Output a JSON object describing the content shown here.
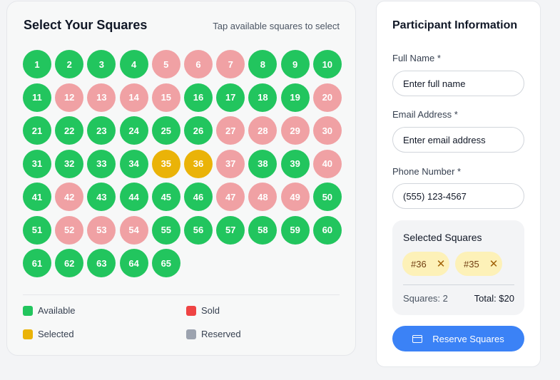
{
  "squares_panel": {
    "title": "Select Your Squares",
    "hint": "Tap available squares to select",
    "squares": [
      {
        "n": "1",
        "s": "available"
      },
      {
        "n": "2",
        "s": "available"
      },
      {
        "n": "3",
        "s": "available"
      },
      {
        "n": "4",
        "s": "available"
      },
      {
        "n": "5",
        "s": "sold"
      },
      {
        "n": "6",
        "s": "sold"
      },
      {
        "n": "7",
        "s": "sold"
      },
      {
        "n": "8",
        "s": "available"
      },
      {
        "n": "9",
        "s": "available"
      },
      {
        "n": "10",
        "s": "available"
      },
      {
        "n": "11",
        "s": "available"
      },
      {
        "n": "12",
        "s": "sold"
      },
      {
        "n": "13",
        "s": "sold"
      },
      {
        "n": "14",
        "s": "sold"
      },
      {
        "n": "15",
        "s": "sold"
      },
      {
        "n": "16",
        "s": "available"
      },
      {
        "n": "17",
        "s": "available"
      },
      {
        "n": "18",
        "s": "available"
      },
      {
        "n": "19",
        "s": "available"
      },
      {
        "n": "20",
        "s": "sold"
      },
      {
        "n": "21",
        "s": "available"
      },
      {
        "n": "22",
        "s": "available"
      },
      {
        "n": "23",
        "s": "available"
      },
      {
        "n": "24",
        "s": "available"
      },
      {
        "n": "25",
        "s": "available"
      },
      {
        "n": "26",
        "s": "available"
      },
      {
        "n": "27",
        "s": "sold"
      },
      {
        "n": "28",
        "s": "sold"
      },
      {
        "n": "29",
        "s": "sold"
      },
      {
        "n": "30",
        "s": "sold"
      },
      {
        "n": "31",
        "s": "available"
      },
      {
        "n": "32",
        "s": "available"
      },
      {
        "n": "33",
        "s": "available"
      },
      {
        "n": "34",
        "s": "available"
      },
      {
        "n": "35",
        "s": "selected"
      },
      {
        "n": "36",
        "s": "selected"
      },
      {
        "n": "37",
        "s": "sold"
      },
      {
        "n": "38",
        "s": "available"
      },
      {
        "n": "39",
        "s": "available"
      },
      {
        "n": "40",
        "s": "sold"
      },
      {
        "n": "41",
        "s": "available"
      },
      {
        "n": "42",
        "s": "sold"
      },
      {
        "n": "43",
        "s": "available"
      },
      {
        "n": "44",
        "s": "available"
      },
      {
        "n": "45",
        "s": "available"
      },
      {
        "n": "46",
        "s": "available"
      },
      {
        "n": "47",
        "s": "sold"
      },
      {
        "n": "48",
        "s": "sold"
      },
      {
        "n": "49",
        "s": "sold"
      },
      {
        "n": "50",
        "s": "available"
      },
      {
        "n": "51",
        "s": "available"
      },
      {
        "n": "52",
        "s": "sold"
      },
      {
        "n": "53",
        "s": "sold"
      },
      {
        "n": "54",
        "s": "sold"
      },
      {
        "n": "55",
        "s": "available"
      },
      {
        "n": "56",
        "s": "available"
      },
      {
        "n": "57",
        "s": "available"
      },
      {
        "n": "58",
        "s": "available"
      },
      {
        "n": "59",
        "s": "available"
      },
      {
        "n": "60",
        "s": "available"
      },
      {
        "n": "61",
        "s": "available"
      },
      {
        "n": "62",
        "s": "available"
      },
      {
        "n": "63",
        "s": "available"
      },
      {
        "n": "64",
        "s": "available"
      },
      {
        "n": "65",
        "s": "available"
      }
    ],
    "legend": {
      "available": "Available",
      "sold": "Sold",
      "selected": "Selected",
      "reserved": "Reserved"
    },
    "colors": {
      "available": "#22c55e",
      "sold_square": "#f0a1a4",
      "sold_legend": "#ef4444",
      "selected": "#eab308",
      "reserved": "#9ca3af"
    }
  },
  "participant": {
    "title": "Participant Information",
    "full_name_label": "Full Name *",
    "full_name_placeholder": "Enter full name",
    "email_label": "Email Address *",
    "email_placeholder": "Enter email address",
    "phone_label": "Phone Number *",
    "phone_placeholder": "(555) 123-4567"
  },
  "selection": {
    "title": "Selected Squares",
    "chips": [
      "#36",
      "#35"
    ],
    "remove_icon": "close-icon",
    "count_text": "Squares: 2",
    "total_text": "Total: $20"
  },
  "reserve_button": {
    "label": "Reserve Squares",
    "icon": "credit-card-icon",
    "color": "#3b82f6"
  }
}
